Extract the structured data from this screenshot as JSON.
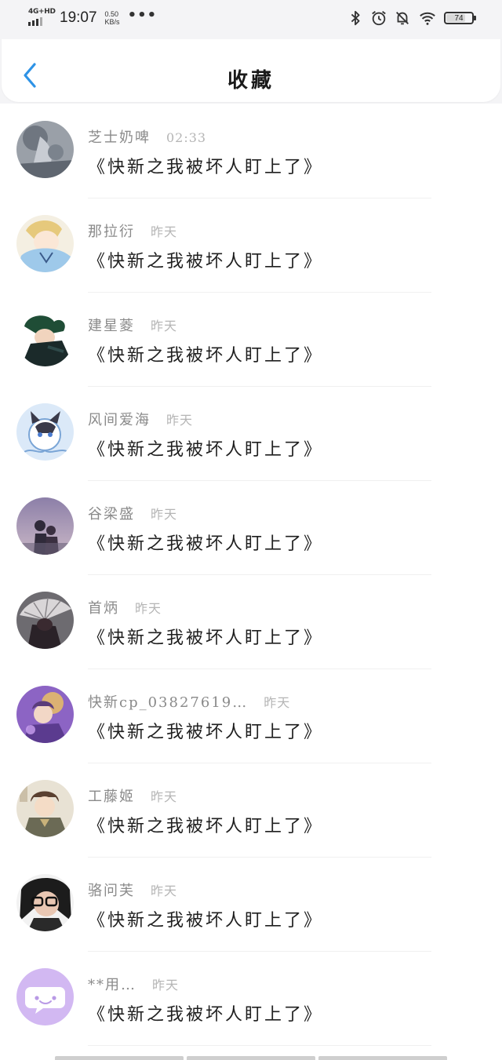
{
  "status_bar": {
    "network": "4G+HD",
    "time": "19:07",
    "speed_value": "0.50",
    "speed_unit": "KB/s",
    "more": "•••",
    "battery_level": "74",
    "battery_fraction": 0.74,
    "icons": [
      "bluetooth-icon",
      "alarm-icon",
      "mute-icon",
      "wifi-icon",
      "battery-icon"
    ]
  },
  "header": {
    "title": "收藏",
    "back_icon": "chevron-left-icon",
    "accent_color": "#2e93e6"
  },
  "items": [
    {
      "name": "芝士奶啤",
      "time": "02:33",
      "title": "《快新之我被坏人盯上了》",
      "avatar": "gray-photo"
    },
    {
      "name": "那拉衍",
      "time": "昨天",
      "title": "《快新之我被坏人盯上了》",
      "avatar": "anime-blue-yellow"
    },
    {
      "name": "建星菱",
      "time": "昨天",
      "title": "《快新之我被坏人盯上了》",
      "avatar": "anime-green-dark"
    },
    {
      "name": "风间爱海",
      "time": "昨天",
      "title": "《快新之我被坏人盯上了》",
      "avatar": "cat-blue"
    },
    {
      "name": "谷梁盛",
      "time": "昨天",
      "title": "《快新之我被坏人盯上了》",
      "avatar": "couple-dusk"
    },
    {
      "name": "首炳",
      "time": "昨天",
      "title": "《快新之我被坏人盯上了》",
      "avatar": "dark-umbrella"
    },
    {
      "name": "快新cp_03827619…",
      "time": "昨天",
      "title": "《快新之我被坏人盯上了》",
      "avatar": "purple-magic"
    },
    {
      "name": "工藤姬",
      "time": "昨天",
      "title": "《快新之我被坏人盯上了》",
      "avatar": "anime-boy-brown"
    },
    {
      "name": "骆问芙",
      "time": "昨天",
      "title": "《快新之我被坏人盯上了》",
      "avatar": "glasses-girl"
    },
    {
      "name": "**用…",
      "time": "昨天",
      "title": "《快新之我被坏人盯上了》",
      "avatar": "default-chat-purple"
    }
  ]
}
